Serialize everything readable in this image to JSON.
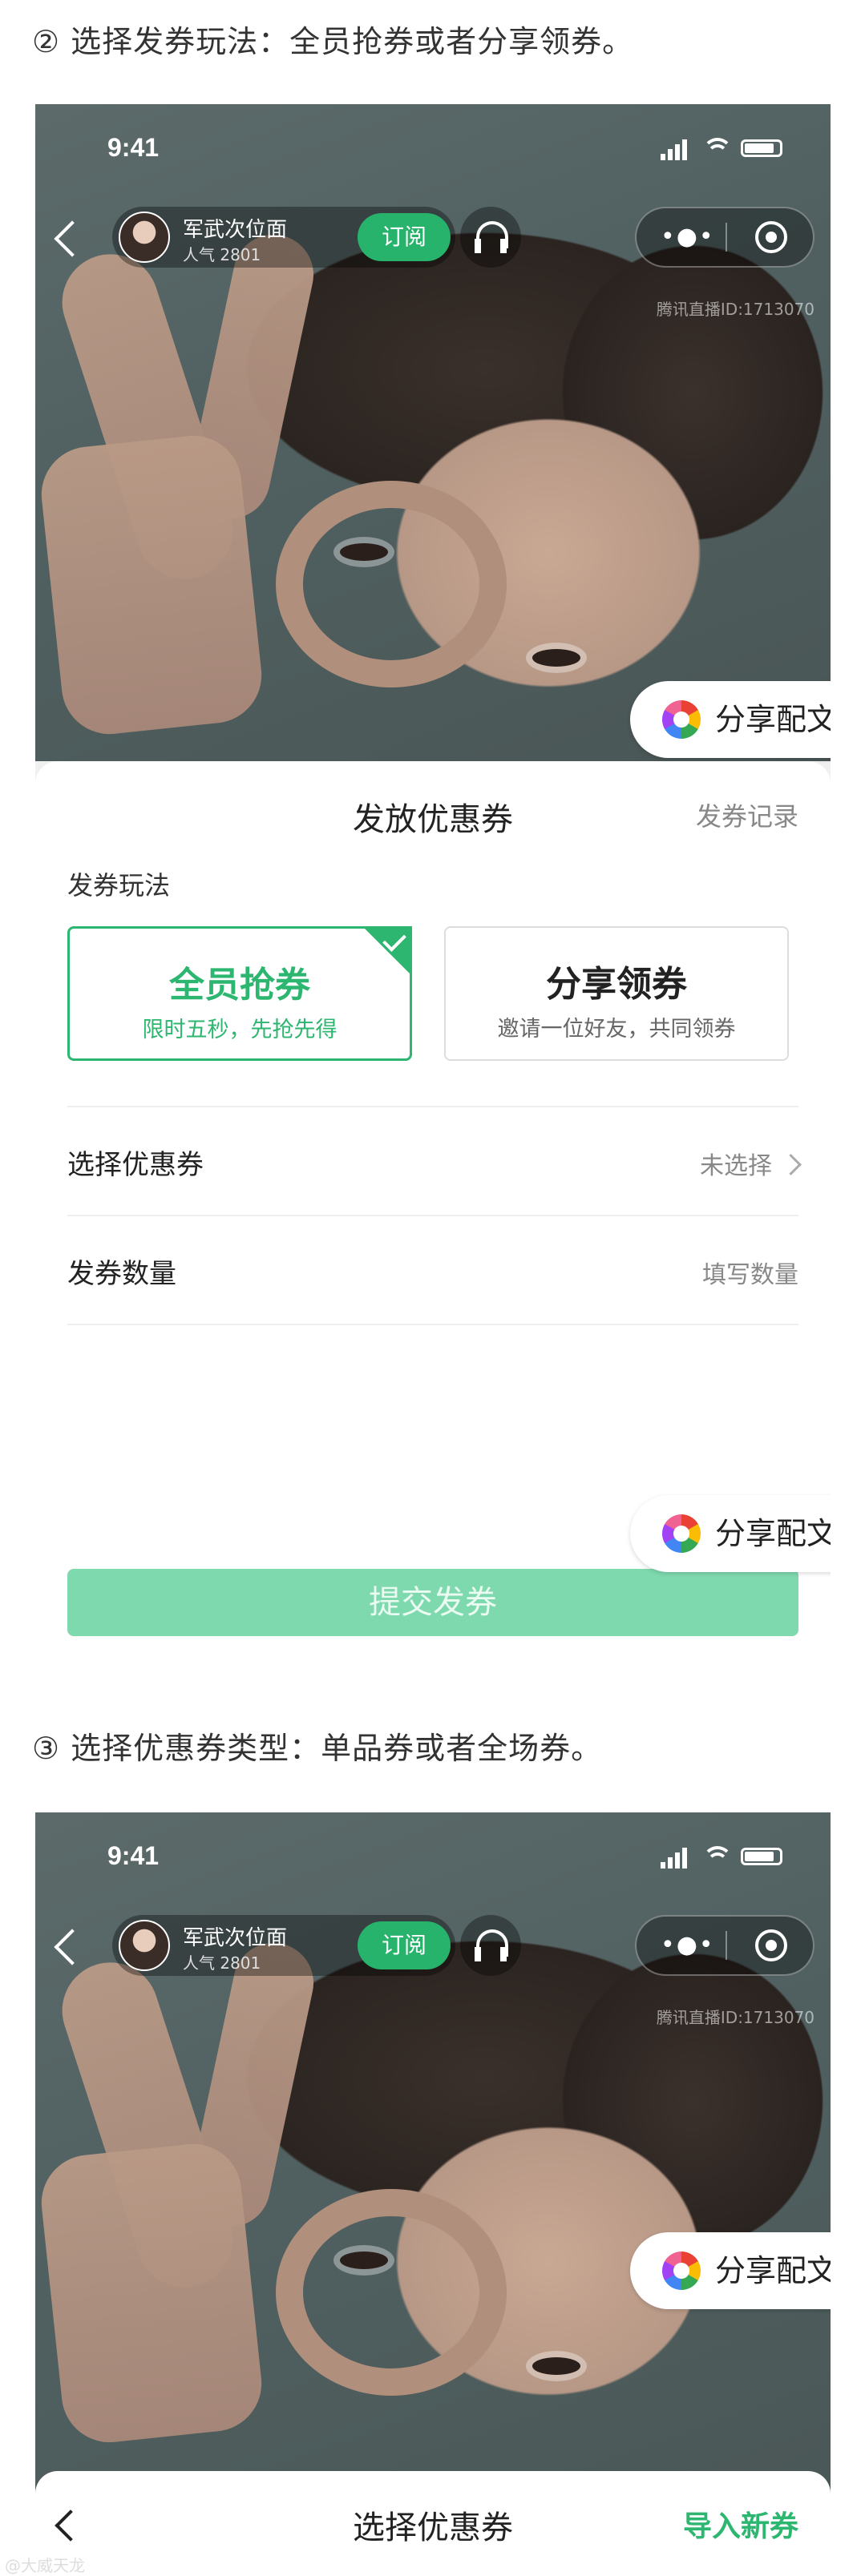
{
  "captions": {
    "step2": "② 选择发券玩法：全员抢券或者分享领券。",
    "step3": "③ 选择优惠券类型：单品券或者全场券。"
  },
  "phone": {
    "time": "9:41",
    "anchor_name": "军武次位面",
    "anchor_popularity": "人气 2801",
    "subscribe_label": "订阅",
    "room_id": "腾讯直播ID:1713070"
  },
  "share_pill": {
    "label": "分享配文"
  },
  "sheet1": {
    "title": "发放优惠券",
    "records_link": "发券记录",
    "mode_label": "发券玩法",
    "mode_all": {
      "title": "全员抢券",
      "desc": "限时五秒，先抢先得"
    },
    "mode_share": {
      "title": "分享领券",
      "desc": "邀请一位好友，共同领券"
    },
    "select_coupon": {
      "label": "选择优惠券",
      "value": "未选择"
    },
    "quantity": {
      "label": "发券数量",
      "placeholder": "填写数量"
    },
    "submit_label": "提交发券"
  },
  "sheet2": {
    "title": "选择优惠券",
    "import_link": "导入新券"
  },
  "watermark": "@大威天龙",
  "colors": {
    "accent_green": "#2db670",
    "submit_green_disabled": "#7fd9ae",
    "subscribe_green": "#27b36b"
  },
  "icons": [
    "back-icon",
    "signal-icon",
    "wifi-icon",
    "battery-icon",
    "headphone-icon",
    "more-icon",
    "record-icon",
    "share-app-icon",
    "check-icon",
    "chevron-right-icon"
  ]
}
